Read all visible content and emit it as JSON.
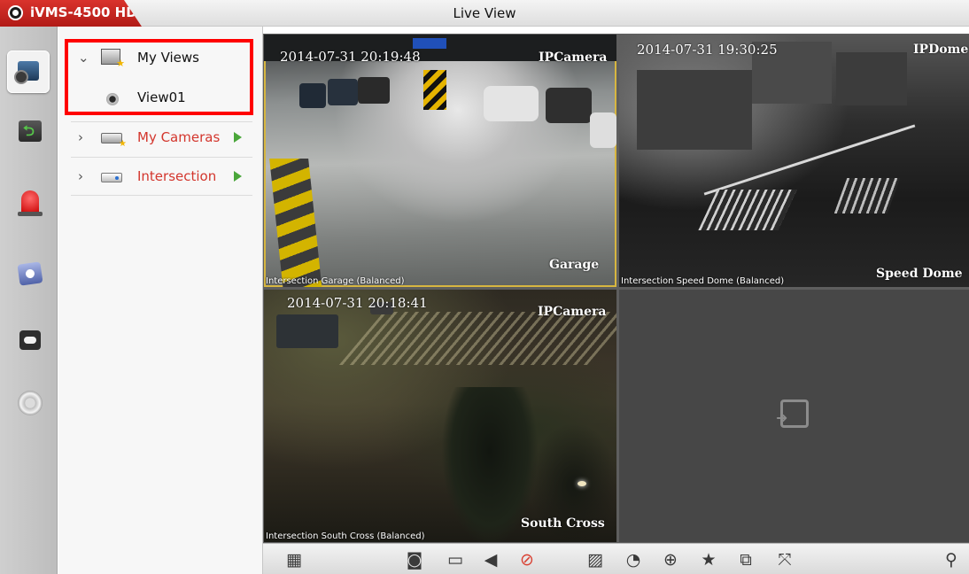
{
  "window": {
    "app_name": "iVMS-4500 HD",
    "title": "Live View"
  },
  "rail": {
    "items": [
      {
        "name": "live-view",
        "active": true
      },
      {
        "name": "playback"
      },
      {
        "name": "alarm"
      },
      {
        "name": "pictures-videos"
      },
      {
        "name": "cloud"
      },
      {
        "name": "settings"
      }
    ]
  },
  "tree": {
    "my_views": "My Views",
    "view01": "View01",
    "my_cameras": "My Cameras",
    "intersection": "Intersection"
  },
  "tiles": {
    "t1": {
      "timestamp": "2014-07-31 20:19:48",
      "camera_label": "IPCamera",
      "location_label": "Garage",
      "caption": "Intersection Garage (Balanced)"
    },
    "t2": {
      "timestamp": "2014-07-31 19:30:25",
      "camera_label": "IPDome",
      "location_label": "Speed Dome",
      "caption": "Intersection Speed Dome (Balanced)"
    },
    "t3": {
      "timestamp": "2014-07-31 20:18:41",
      "camera_label": "IPCamera",
      "location_label": "South Cross",
      "caption": "Intersection South Cross (Balanced)"
    }
  },
  "toolbar": {
    "icons": [
      "grid-layout",
      "snapshot",
      "record",
      "audio",
      "two-way-audio",
      "image-quality",
      "alarm-output",
      "digital-zoom",
      "favorite",
      "close-all",
      "fullscreen",
      "ptz"
    ]
  },
  "colors": {
    "brand_red": "#c8221d",
    "highlight_red": "#ff0000",
    "selected_tile_border": "#d7b640",
    "tree_red_text": "#d3362d",
    "play_green": "#4aa63a"
  }
}
